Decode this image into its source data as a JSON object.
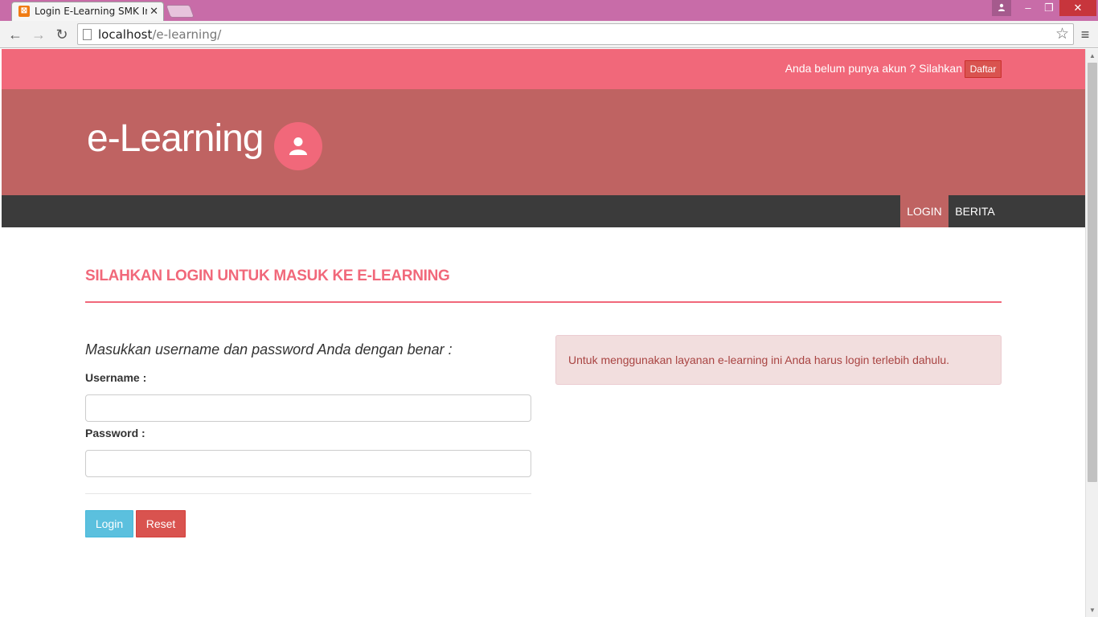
{
  "browser": {
    "tab_title": "Login E-Learning SMK Indonesia",
    "url_host": "localhost",
    "url_path": "/e-learning/"
  },
  "topbar": {
    "prompt": "Anda belum punya akun ? Silahkan",
    "register_label": "Daftar"
  },
  "header": {
    "brand": "e-Learning"
  },
  "nav": {
    "items": [
      {
        "label": "LOGIN",
        "active": true
      },
      {
        "label": "BERITA",
        "active": false
      }
    ]
  },
  "main": {
    "title": "SILAHKAN LOGIN UNTUK MASUK KE E-LEARNING",
    "lead": "Masukkan username dan password Anda dengan benar :",
    "username_label": "Username :",
    "username_value": "",
    "password_label": "Password :",
    "password_value": "",
    "login_label": "Login",
    "reset_label": "Reset",
    "alert": "Untuk menggunakan layanan e-learning ini Anda harus login terlebih dahulu."
  },
  "colors": {
    "topbar": "#f1687a",
    "header": "#bf6362",
    "navbar": "#3b3b3b",
    "info_button": "#5bc0de",
    "danger_button": "#d9534f",
    "alert_bg": "#f2dede"
  },
  "icons": {
    "favicon": "xampp-icon",
    "user": "user-icon"
  }
}
